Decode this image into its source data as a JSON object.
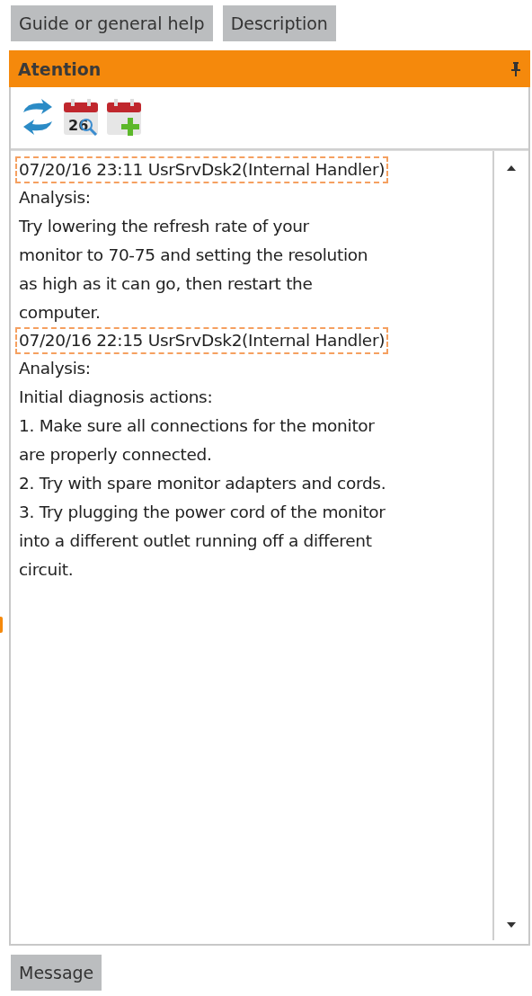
{
  "tabs": [
    {
      "label": "Guide or general help"
    },
    {
      "label": "Description"
    }
  ],
  "panel": {
    "title": "Atention",
    "toolbar": [
      {
        "kind": "refresh"
      },
      {
        "kind": "calendar-search",
        "day": "26"
      },
      {
        "kind": "calendar-add"
      }
    ],
    "entries": [
      {
        "header": "07/20/16 23:11 UsrSrvDsk2(Internal Handler)",
        "label": "Analysis:",
        "body": "Try lowering the refresh rate of your\nmonitor to 70-75 and setting the resolution\nas high as it can go, then restart the\ncomputer."
      },
      {
        "header": "07/20/16 22:15 UsrSrvDsk2(Internal Handler)",
        "label": "Analysis:",
        "body": "Initial diagnosis actions:\n1. Make sure all connections for the monitor\nare properly connected.\n2. Try with spare monitor adapters and cords.\n3. Try plugging the power cord of the monitor\ninto a different outlet running off a different\ncircuit."
      }
    ]
  },
  "bottom_tabs": [
    {
      "label": "Message"
    }
  ]
}
